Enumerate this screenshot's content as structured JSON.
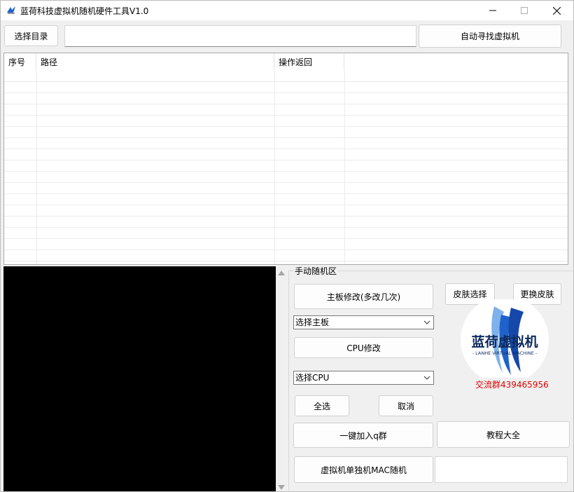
{
  "window": {
    "title": "蓝荷科技虚拟机随机硬件工具V1.0"
  },
  "toolbar": {
    "select_dir_label": "选择目录",
    "dir_path_value": "",
    "auto_find_label": "自动寻找虚拟机"
  },
  "table": {
    "columns": [
      "序号",
      "路径",
      "操作返回"
    ],
    "rows": []
  },
  "manual_panel": {
    "group_title": "手动随机区",
    "motherboard_button": "主板修改(多改几次)",
    "motherboard_select": "选择主板",
    "cpu_button": "CPU修改",
    "cpu_select": "选择CPU",
    "select_all_button": "全选",
    "cancel_button": "取消",
    "join_qq_button": "一键加入q群",
    "tutorial_button": "教程大全",
    "mac_random_button": "虚拟机单独机MAC随机",
    "extra_field_value": ""
  },
  "skin": {
    "select_skin_label": "皮肤选择",
    "change_skin_label": "更换皮肤"
  },
  "logo": {
    "title": "蓝荷虚拟机",
    "subtitle": "- LANHE VIRTUAL MACHINE -"
  },
  "contact": {
    "qq_group": "交流群439465956"
  },
  "colors": {
    "accent_blue": "#1f62c9",
    "logo_text": "#0d2a5c",
    "qq_text": "#e00000",
    "console_bg": "#000000"
  },
  "icons": {
    "app": "app-logo-icon",
    "minimize": "minimize-icon",
    "maximize": "maximize-icon",
    "close": "close-icon",
    "dropdown": "chevron-down-icon",
    "scroll_up": "scroll-up-icon",
    "scroll_down": "scroll-down-icon"
  }
}
